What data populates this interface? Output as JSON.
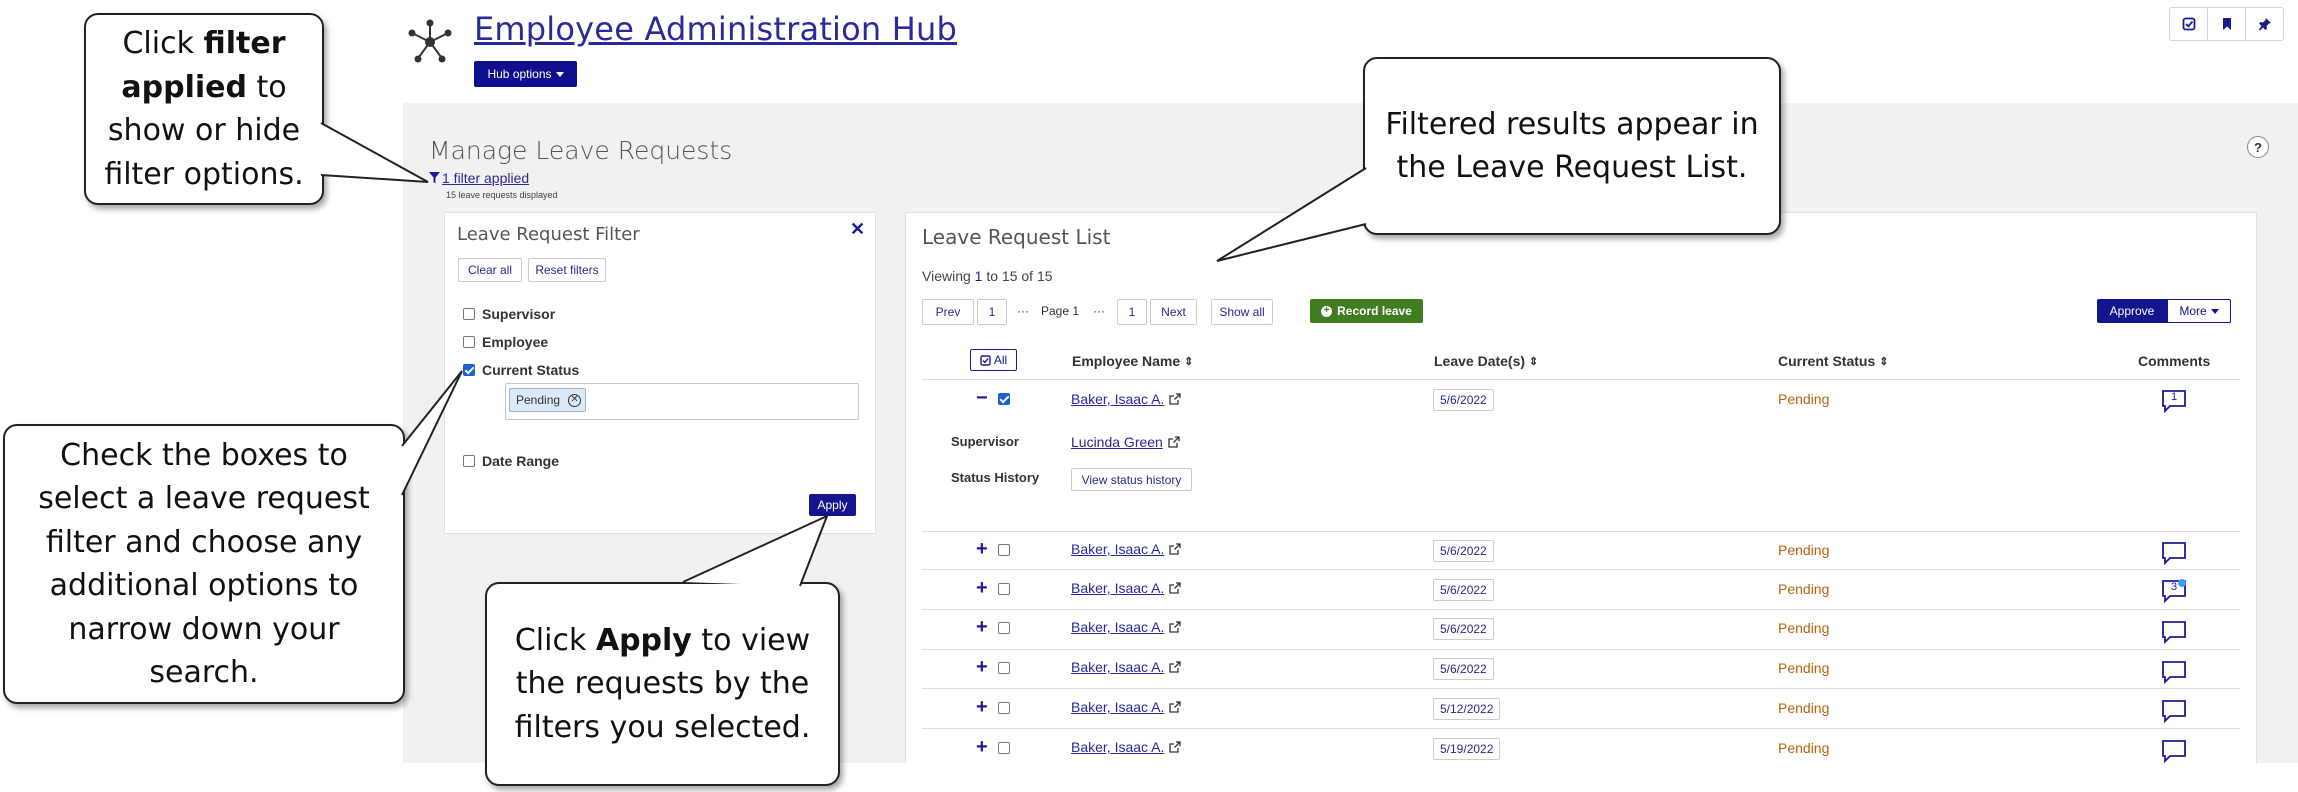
{
  "header": {
    "title": "Employee Administration Hub",
    "hub_options_label": "Hub options"
  },
  "page": {
    "heading": "Manage Leave Requests",
    "filter_toggle_label": "1 filter applied",
    "requests_count": "15 leave requests displayed",
    "help_label": "?"
  },
  "filter_panel": {
    "title": "Leave Request Filter",
    "clear_all_label": "Clear all",
    "reset_filters_label": "Reset filters",
    "filters": [
      {
        "label": "Supervisor",
        "checked": false
      },
      {
        "label": "Employee",
        "checked": false
      },
      {
        "label": "Current Status",
        "checked": true
      },
      {
        "label": "Date Range",
        "checked": false
      }
    ],
    "status_chip": "Pending",
    "apply_label": "Apply"
  },
  "list_panel": {
    "title": "Leave Request List",
    "viewing_prefix": "Viewing ",
    "viewing_start": "1",
    "viewing_middle": " to 15 of 15",
    "pagination": {
      "prev_label": "Prev",
      "first_page": "1",
      "ellipsis": "···",
      "current_page": "Page 1",
      "last_page": "1",
      "next_label": "Next",
      "show_all_label": "Show all"
    },
    "record_leave_label": "Record leave",
    "approve_label": "Approve",
    "more_label": "More",
    "all_label": "All",
    "columns": [
      "Employee Name",
      "Leave Date(s)",
      "Current Status",
      "Comments"
    ],
    "expanded_detail": {
      "supervisor_label": "Supervisor",
      "supervisor_name": "Lucinda Green",
      "status_history_label": "Status History",
      "view_history_label": "View status history"
    },
    "rows": [
      {
        "employee": "Baker, Isaac A.",
        "date": "5/6/2022",
        "status": "Pending",
        "comments": "1",
        "expanded": true,
        "checked": true
      },
      {
        "employee": "Baker, Isaac A.",
        "date": "5/6/2022",
        "status": "Pending",
        "comments": "",
        "expanded": false,
        "checked": false
      },
      {
        "employee": "Baker, Isaac A.",
        "date": "5/6/2022",
        "status": "Pending",
        "comments": "3",
        "expanded": false,
        "checked": false
      },
      {
        "employee": "Baker, Isaac A.",
        "date": "5/6/2022",
        "status": "Pending",
        "comments": "",
        "expanded": false,
        "checked": false
      },
      {
        "employee": "Baker, Isaac A.",
        "date": "5/6/2022",
        "status": "Pending",
        "comments": "",
        "expanded": false,
        "checked": false
      },
      {
        "employee": "Baker, Isaac A.",
        "date": "5/12/2022",
        "status": "Pending",
        "comments": "",
        "expanded": false,
        "checked": false
      },
      {
        "employee": "Baker, Isaac A.",
        "date": "5/19/2022",
        "status": "Pending",
        "comments": "",
        "expanded": false,
        "checked": false
      }
    ]
  },
  "callouts": {
    "filter_applied": {
      "pre": "Click ",
      "bold": "filter applied",
      "post": " to show or hide filter options."
    },
    "results": {
      "text": "Filtered results appear in the Leave Request List."
    },
    "checkboxes": {
      "text": "Check the boxes to select a leave request filter and choose any additional options to narrow down your search."
    },
    "apply": {
      "pre": "Click ",
      "bold": "Apply",
      "post": " to view the requests by the filters you selected."
    }
  },
  "colors": {
    "primary": "#14148f",
    "link": "#2a2a9a",
    "pending": "#b8620c",
    "record_green": "#3f7d20",
    "background_grey": "#f1f1f1"
  }
}
